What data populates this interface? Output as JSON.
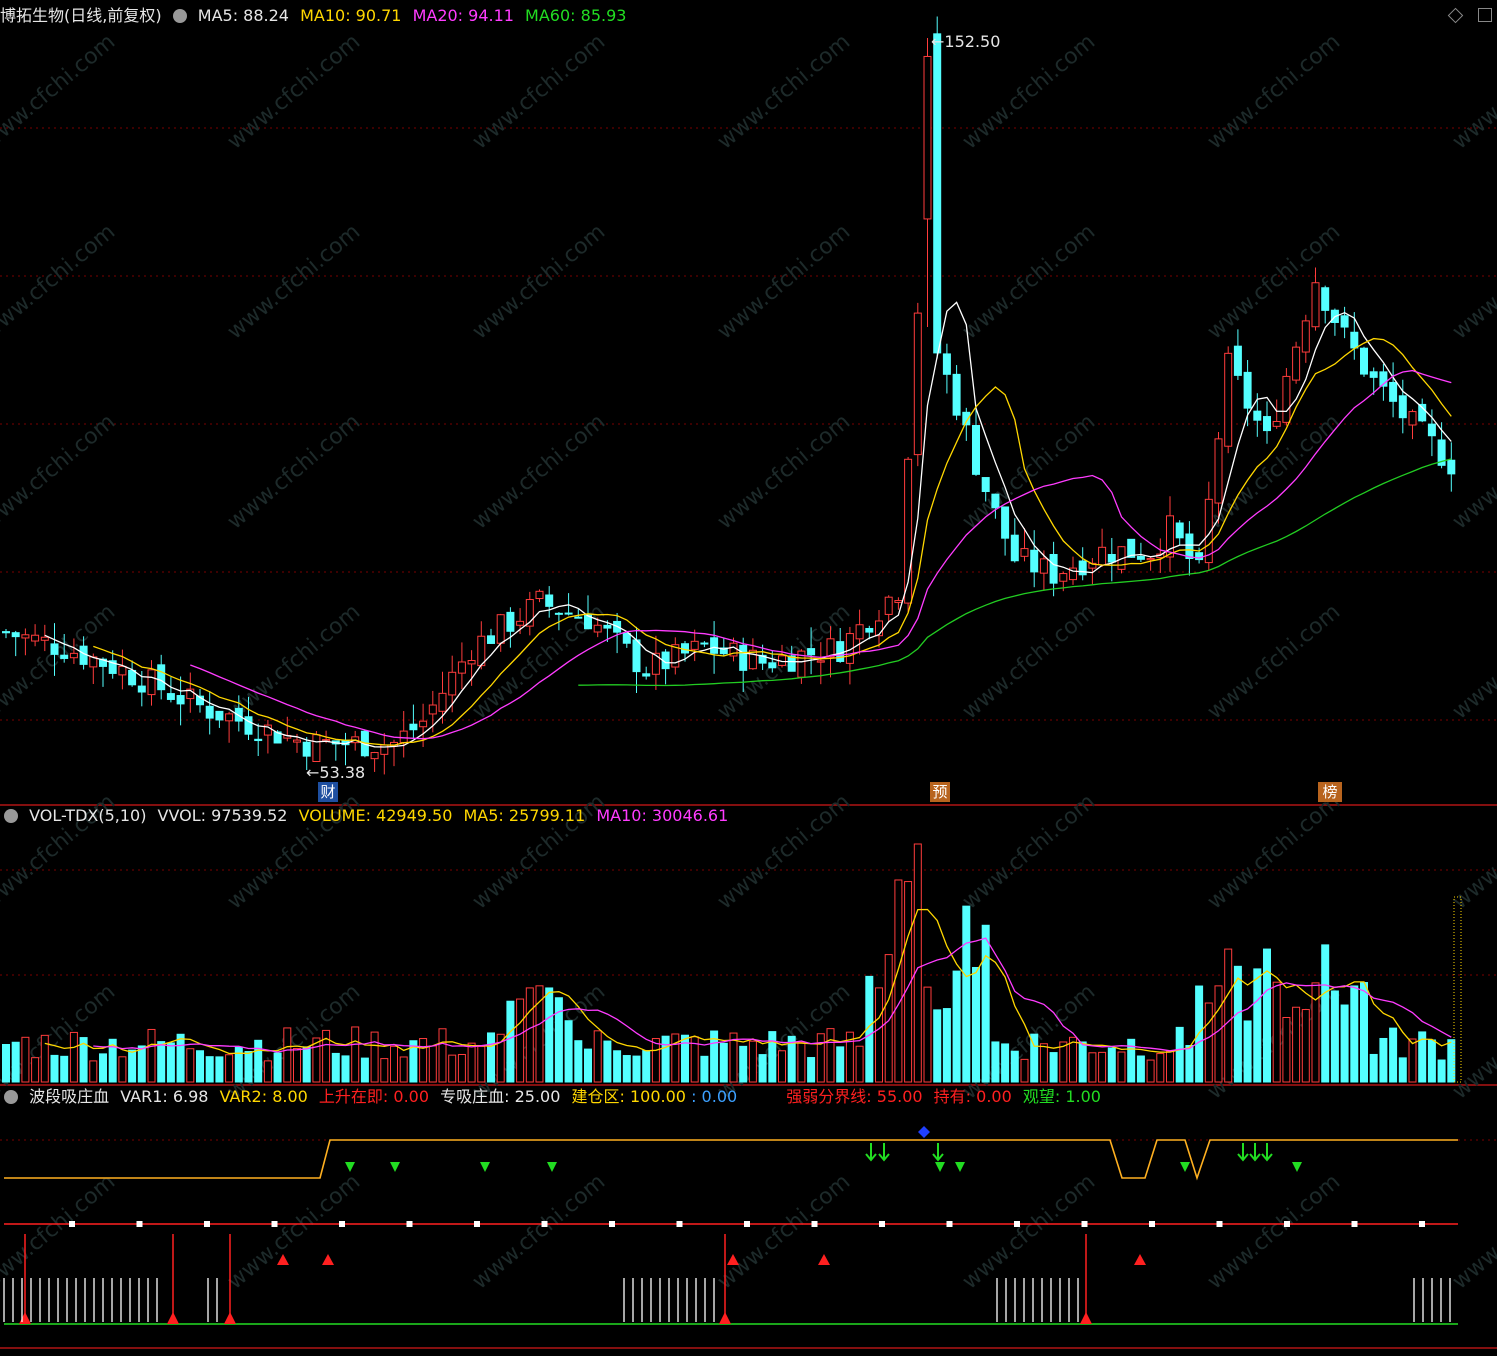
{
  "main_header": {
    "stock_title": "博拓生物(日线,前复权)",
    "ma5": "MA5: 88.24",
    "ma10": "MA10: 90.71",
    "ma20": "MA20: 94.11",
    "ma60": "MA60: 85.93"
  },
  "vol_header": {
    "name": "VOL-TDX(5,10)",
    "vvol": "VVOL: 97539.52",
    "volume": "VOLUME: 42949.50",
    "ma5": "MA5: 25799.11",
    "ma10": "MA10: 30046.61"
  },
  "ind_header": {
    "name": "波段吸庄血",
    "var1": "VAR1: 6.98",
    "var2": "VAR2: 8.00",
    "rise": "上升在即: 0.00",
    "absorb": "专吸庄血: 25.00",
    "build": "建仓区: 100.00",
    "build_extra": ": 0.00",
    "divide": "强弱分界线: 55.00",
    "hold": "持有: 0.00",
    "watch": "观望: 1.00"
  },
  "annotations": {
    "high_label": "152.50",
    "low_label": "53.38",
    "badge_cai": "财",
    "badge_yu": "预",
    "badge_bang": "榜"
  },
  "watermark_text": "www.cfchi.com",
  "colors": {
    "up": "#ff3c3c",
    "down": "#54ffff",
    "ma5": "#ffffff",
    "ma10": "#ffd700",
    "ma20": "#ff3cff",
    "ma60": "#22cc22",
    "grid": "#7a0000",
    "signal_green": "#22dd22",
    "signal_red": "#ff2020",
    "divide_line": "#ff2020",
    "hold_line": "#ffb020"
  },
  "chart_data": [
    {
      "type": "candlestick",
      "title": "博拓生物(日线,前复权)",
      "ylim": [
        53.38,
        152.5
      ],
      "max_price": 152.5,
      "min_price": 53.38,
      "series_names": [
        "MA5",
        "MA10",
        "MA20",
        "MA60"
      ],
      "last_values": {
        "MA5": 88.24,
        "MA10": 90.71,
        "MA20": 94.11,
        "MA60": 85.93
      }
    },
    {
      "type": "bar",
      "title": "VOL-TDX(5,10)",
      "series_names": [
        "VOLUME",
        "MA5",
        "MA10"
      ],
      "last_values": {
        "VVOL": 97539.52,
        "VOLUME": 42949.5,
        "MA5": 25799.11,
        "MA10": 30046.61
      }
    },
    {
      "type": "line",
      "title": "波段吸庄血",
      "last_values": {
        "VAR1": 6.98,
        "VAR2": 8.0,
        "上升在即": 0.0,
        "专吸庄血": 25.0,
        "建仓区": 100.0,
        "强弱分界线": 55.0,
        "持有": 0.0,
        "观望": 1.0
      }
    }
  ]
}
